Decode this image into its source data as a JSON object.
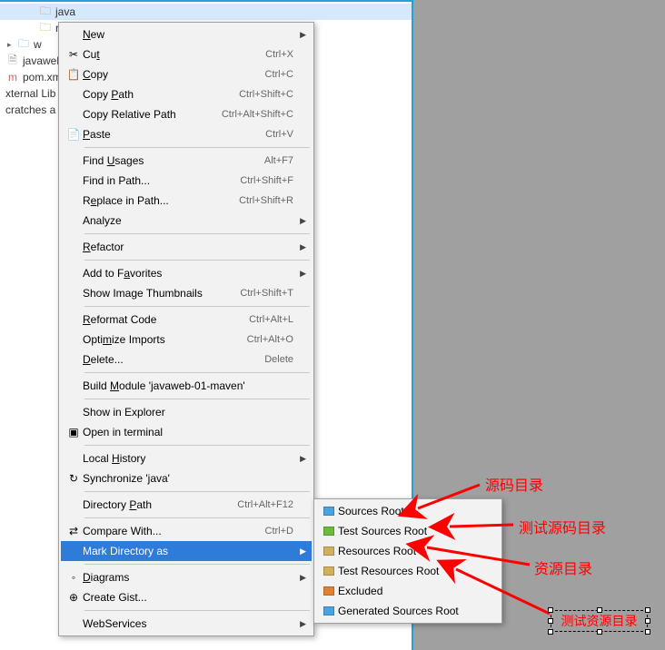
{
  "tree": {
    "items": [
      {
        "indent": 36,
        "icon": "folder",
        "label": "java",
        "selected": true
      },
      {
        "indent": 36,
        "icon": "folder",
        "label": "re"
      },
      {
        "indent": 8,
        "icon": "arrow",
        "label": ""
      },
      {
        "indent": 20,
        "icon": "folder-w",
        "label": "w"
      }
    ],
    "extra": [
      "javaweb",
      "pom.xm",
      "xternal Lib",
      "cratches a"
    ]
  },
  "menu": {
    "sections": [
      [
        {
          "icon": "",
          "label": "New",
          "shortcut": "",
          "arrow": true,
          "u": 0
        },
        {
          "icon": "✂",
          "label": "Cut",
          "shortcut": "Ctrl+X",
          "u": 2
        },
        {
          "icon": "📋",
          "label": "Copy",
          "shortcut": "Ctrl+C",
          "u": 0
        },
        {
          "icon": "",
          "label": "Copy Path",
          "shortcut": "Ctrl+Shift+C",
          "u": 5
        },
        {
          "icon": "",
          "label": "Copy Relative Path",
          "shortcut": "Ctrl+Alt+Shift+C"
        },
        {
          "icon": "📄",
          "label": "Paste",
          "shortcut": "Ctrl+V",
          "u": 0
        }
      ],
      [
        {
          "icon": "",
          "label": "Find Usages",
          "shortcut": "Alt+F7",
          "u": 5
        },
        {
          "icon": "",
          "label": "Find in Path...",
          "shortcut": "Ctrl+Shift+F",
          "u": -1
        },
        {
          "icon": "",
          "label": "Replace in Path...",
          "shortcut": "Ctrl+Shift+R",
          "u": 1
        },
        {
          "icon": "",
          "label": "Analyze",
          "shortcut": "",
          "arrow": true,
          "u": -1
        }
      ],
      [
        {
          "icon": "",
          "label": "Refactor",
          "shortcut": "",
          "arrow": true,
          "u": 0
        }
      ],
      [
        {
          "icon": "",
          "label": "Add to Favorites",
          "shortcut": "",
          "arrow": true,
          "u": 8
        },
        {
          "icon": "",
          "label": "Show Image Thumbnails",
          "shortcut": "Ctrl+Shift+T"
        }
      ],
      [
        {
          "icon": "",
          "label": "Reformat Code",
          "shortcut": "Ctrl+Alt+L",
          "u": 0
        },
        {
          "icon": "",
          "label": "Optimize Imports",
          "shortcut": "Ctrl+Alt+O",
          "u": 4
        },
        {
          "icon": "",
          "label": "Delete...",
          "shortcut": "Delete",
          "u": 0
        }
      ],
      [
        {
          "icon": "",
          "label": "Build Module 'javaweb-01-maven'",
          "shortcut": "",
          "u": 6
        }
      ],
      [
        {
          "icon": "",
          "label": "Show in Explorer",
          "shortcut": ""
        },
        {
          "icon": "▣",
          "label": "Open in terminal",
          "shortcut": ""
        }
      ],
      [
        {
          "icon": "",
          "label": "Local History",
          "shortcut": "",
          "arrow": true,
          "u": 6
        },
        {
          "icon": "↻",
          "label": "Synchronize 'java'",
          "shortcut": ""
        }
      ],
      [
        {
          "icon": "",
          "label": "Directory Path",
          "shortcut": "Ctrl+Alt+F12",
          "u": 10
        }
      ],
      [
        {
          "icon": "⇄",
          "label": "Compare With...",
          "shortcut": "Ctrl+D"
        },
        {
          "icon": "",
          "label": "Mark Directory as",
          "shortcut": "",
          "arrow": true,
          "selected": true
        }
      ],
      [
        {
          "icon": "◦",
          "label": "Diagrams",
          "shortcut": "",
          "arrow": true,
          "u": 0
        },
        {
          "icon": "⊕",
          "label": "Create Gist...",
          "shortcut": ""
        }
      ],
      [
        {
          "icon": "",
          "label": "WebServices",
          "shortcut": "",
          "arrow": true
        }
      ]
    ]
  },
  "submenu": {
    "items": [
      {
        "color": "#4aa3df",
        "label": "Sources Root"
      },
      {
        "color": "#6cbb3c",
        "label": "Test Sources Root"
      },
      {
        "color": "#d0b060",
        "label": "Resources Root"
      },
      {
        "color": "#d0b060",
        "label": "Test Resources Root"
      },
      {
        "color": "#e08030",
        "label": "Excluded"
      },
      {
        "color": "#4aa3df",
        "label": "Generated Sources Root"
      }
    ]
  },
  "annotations": {
    "a1": "源码目录",
    "a2": "测试源码目录",
    "a3": "资源目录",
    "a4": "测试资源目录"
  }
}
